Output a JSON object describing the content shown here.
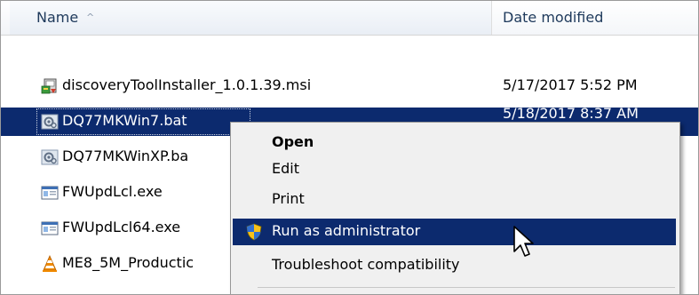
{
  "header": {
    "name_label": "Name",
    "sort_glyph": "^",
    "date_label": "Date modified"
  },
  "files": [
    {
      "name": "discoveryToolInstaller_1.0.1.39.msi",
      "date": "5/17/2017 5:52 PM",
      "icon": "msi-installer-icon",
      "selected": false
    },
    {
      "name": "DQ77MKWin7.bat",
      "date": "5/18/2017 8:37 AM",
      "icon": "batch-file-icon",
      "selected": true
    },
    {
      "name": "DQ77MKWinXP.ba",
      "date": "",
      "icon": "batch-file-icon",
      "selected": false
    },
    {
      "name": "FWUpdLcl.exe",
      "date": "",
      "icon": "exe-app-icon",
      "selected": false
    },
    {
      "name": "FWUpdLcl64.exe",
      "date": "",
      "icon": "exe-app-icon",
      "selected": false
    },
    {
      "name": "ME8_5M_Productic",
      "date": "",
      "icon": "vlc-cone-icon",
      "selected": false
    }
  ],
  "context_menu": {
    "items": [
      {
        "label": "Open",
        "bold": true,
        "highlighted": false
      },
      {
        "label": "Edit",
        "bold": false,
        "highlighted": false
      },
      {
        "label": "Print",
        "bold": false,
        "highlighted": false
      },
      {
        "label": "Run as administrator",
        "bold": false,
        "highlighted": true,
        "icon": "uac-shield-icon"
      },
      {
        "label": "Troubleshoot compatibility",
        "bold": false,
        "highlighted": false
      }
    ]
  },
  "colors": {
    "selection": "#0c2a6e",
    "header_text": "#1e395b",
    "menu_bg": "#f0f0f0"
  }
}
